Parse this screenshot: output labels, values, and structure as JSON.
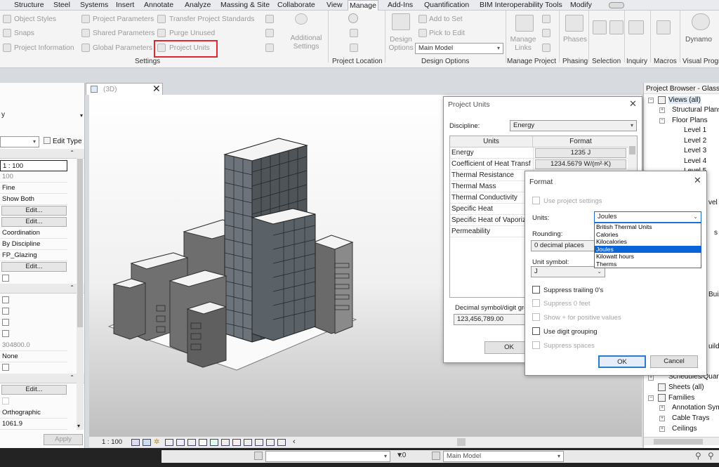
{
  "ribbon_tabs": [
    "Structure",
    "Steel",
    "Systems",
    "Insert",
    "Annotate",
    "Analyze",
    "Massing & Site",
    "Collaborate",
    "View",
    "Manage",
    "Add-Ins",
    "Quantification",
    "BIM Interoperability Tools",
    "Modify"
  ],
  "settings_panel": {
    "items": [
      "Object Styles",
      "Snaps",
      "Project Information",
      "Project Parameters",
      "Shared Parameters",
      "Global Parameters",
      "Transfer Project Standards",
      "Purge Unused",
      "Project Units"
    ],
    "additional_settings": "Additional Settings",
    "group_label": "Settings"
  },
  "project_location": {
    "group_label": "Project Location"
  },
  "design_options": {
    "add_to_set": "Add to Set",
    "pick_to_edit": "Pick to Edit",
    "design_options": "Design Options",
    "main_model": "Main Model",
    "group_label": "Design Options"
  },
  "manage_project": {
    "manage_links": "Manage Links",
    "group_label": "Manage Project"
  },
  "phasing": {
    "phases": "Phases",
    "group_label": "Phasing"
  },
  "groups_right": [
    "Selection",
    "Inquiry",
    "Macros",
    "Visual Progr"
  ],
  "dynamo": "Dynamo",
  "properties": {
    "edit_type": "Edit Type",
    "rows": [
      "1 : 100",
      "100",
      "Fine",
      "Show Both",
      "Edit...",
      "Edit...",
      "Coordination",
      "By Discipline",
      "FP_Glazing",
      "Edit...",
      "304800.0",
      "None",
      "Edit...",
      "Orthographic",
      "1061.9"
    ],
    "apply": "Apply"
  },
  "view": {
    "tab": "(3D)",
    "scale": "1 : 100"
  },
  "browser": {
    "title": "Project Browser - Glass T",
    "items": [
      "Views (all)",
      "Structural Plans",
      "Floor Plans",
      "Level 1",
      "Level 2",
      "Level 3",
      "Level 4",
      "Level 5",
      "vel",
      "s",
      "Buil",
      "uildi",
      "Schedules/Quan",
      "Sheets (all)",
      "Families",
      "Annotation Sym",
      "Cable Trays",
      "Ceilings"
    ]
  },
  "status": {
    "zero": ":0",
    "main_model": "Main Model"
  },
  "project_units": {
    "title": "Project Units",
    "discipline_label": "Discipline:",
    "discipline_value": "Energy",
    "col_units": "Units",
    "col_format": "Format",
    "rows": [
      {
        "unit": "Energy",
        "format": "1235 J"
      },
      {
        "unit": "Coefficient of Heat Transf",
        "format": "1234.5679 W/(m²·K)"
      },
      {
        "unit": "Thermal Resistance",
        "format": ""
      },
      {
        "unit": "Thermal Mass",
        "format": ""
      },
      {
        "unit": "Thermal Conductivity",
        "format": ""
      },
      {
        "unit": "Specific Heat",
        "format": ""
      },
      {
        "unit": "Specific Heat of Vaporiz",
        "format": ""
      },
      {
        "unit": "Permeability",
        "format": ""
      }
    ],
    "decimal_label": "Decimal symbol/digit grouping:",
    "decimal_value": "123,456,789.00",
    "ok": "OK"
  },
  "format_dialog": {
    "title": "Format",
    "use_project_settings": "Use project settings",
    "units_label": "Units:",
    "units_value": "Joules",
    "unit_options": [
      "British Thermal Units",
      "Calories",
      "Kilocalories",
      "Joules",
      "Kilowatt hours",
      "Therms"
    ],
    "selected_option": "Joules",
    "rounding_label": "Rounding:",
    "rounding_value": "0 decimal places",
    "unit_symbol_label": "Unit symbol:",
    "unit_symbol_value": "J",
    "suppress_trailing": "Suppress trailing 0's",
    "suppress_0_feet": "Suppress 0 feet",
    "show_plus": "Show + for positive values",
    "digit_grouping": "Use digit grouping",
    "suppress_spaces": "Suppress spaces",
    "ok": "OK",
    "cancel": "Cancel"
  },
  "colors": {
    "highlight": "#e0262e",
    "selection": "#0a64d8",
    "accent": "#2b7bd0"
  }
}
